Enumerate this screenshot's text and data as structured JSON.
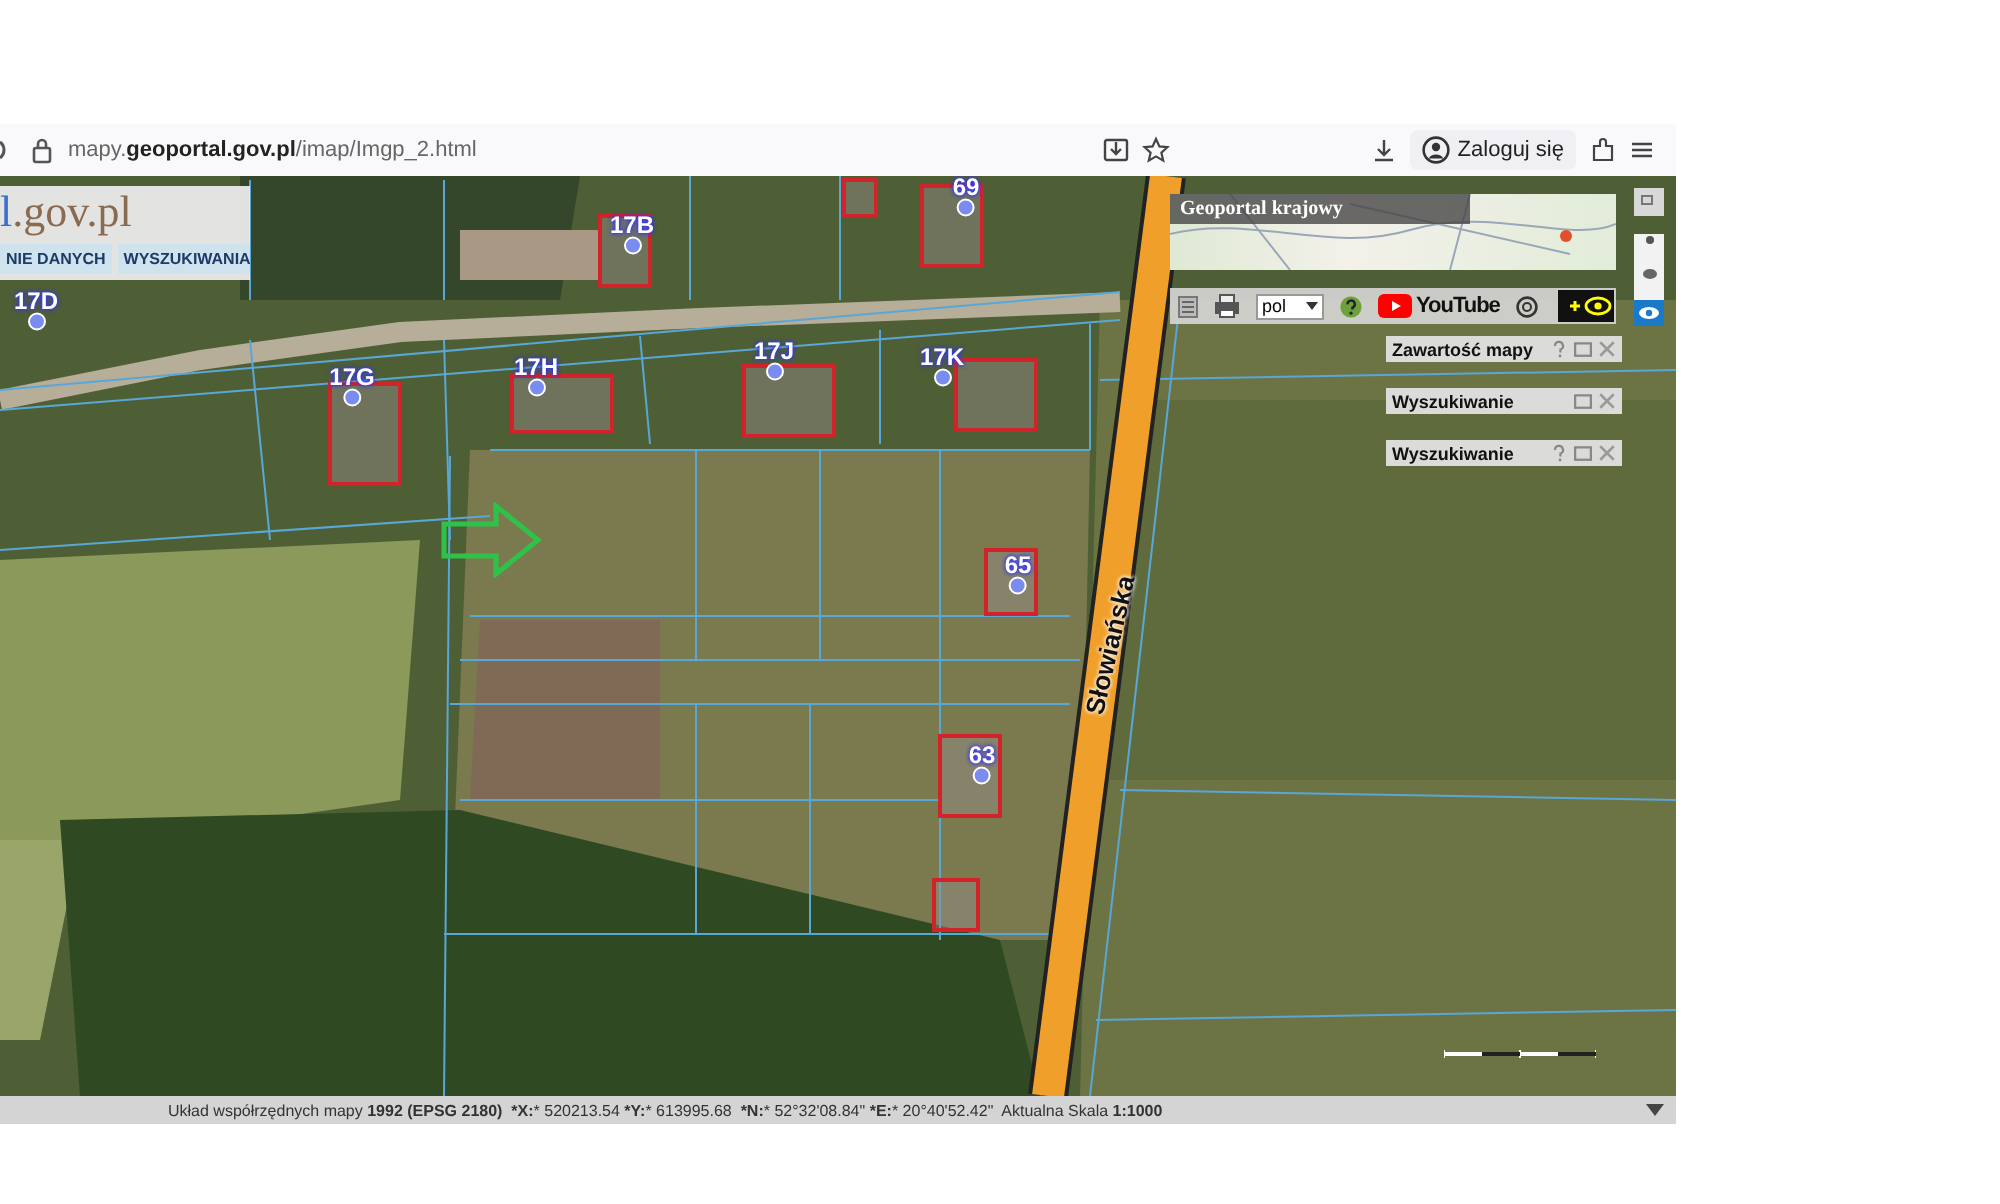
{
  "browser": {
    "url_host": "mapy.",
    "url_domain": "geoportal.gov.pl",
    "url_path": "/imap/Imgp_2.html",
    "login": "Zaloguj się"
  },
  "logo": {
    "prefix": "l",
    "suffix": ".gov.pl"
  },
  "menu": [
    {
      "label": "NIE DANYCH"
    },
    {
      "label": "WYSZUKIWANIA"
    }
  ],
  "overview": {
    "title": "Geoportal krajowy"
  },
  "toolbar": {
    "language": "pol",
    "video_label": "YouTube"
  },
  "panels": [
    {
      "title": "Zawartość mapy",
      "help": true
    },
    {
      "title": "Wyszukiwanie",
      "help": false
    },
    {
      "title": "Wyszukiwanie",
      "help": true
    }
  ],
  "map": {
    "street": "Słowiańska",
    "addresses": [
      {
        "label": "17D"
      },
      {
        "label": "17B"
      },
      {
        "label": "69"
      },
      {
        "label": "17G"
      },
      {
        "label": "17H"
      },
      {
        "label": "17J"
      },
      {
        "label": "17K"
      },
      {
        "label": "65"
      },
      {
        "label": "63"
      }
    ]
  },
  "status_bar": {
    "text": "Układ współrzędnych mapy **1992 (EPSG 2180)**  ***X:*** 520213.54 ***Y:*** 613995.68  ***N:*** 52°32'08.84\" ***E:*** 20°40'52.42\"  Aktualna Skala **1:1000**"
  }
}
